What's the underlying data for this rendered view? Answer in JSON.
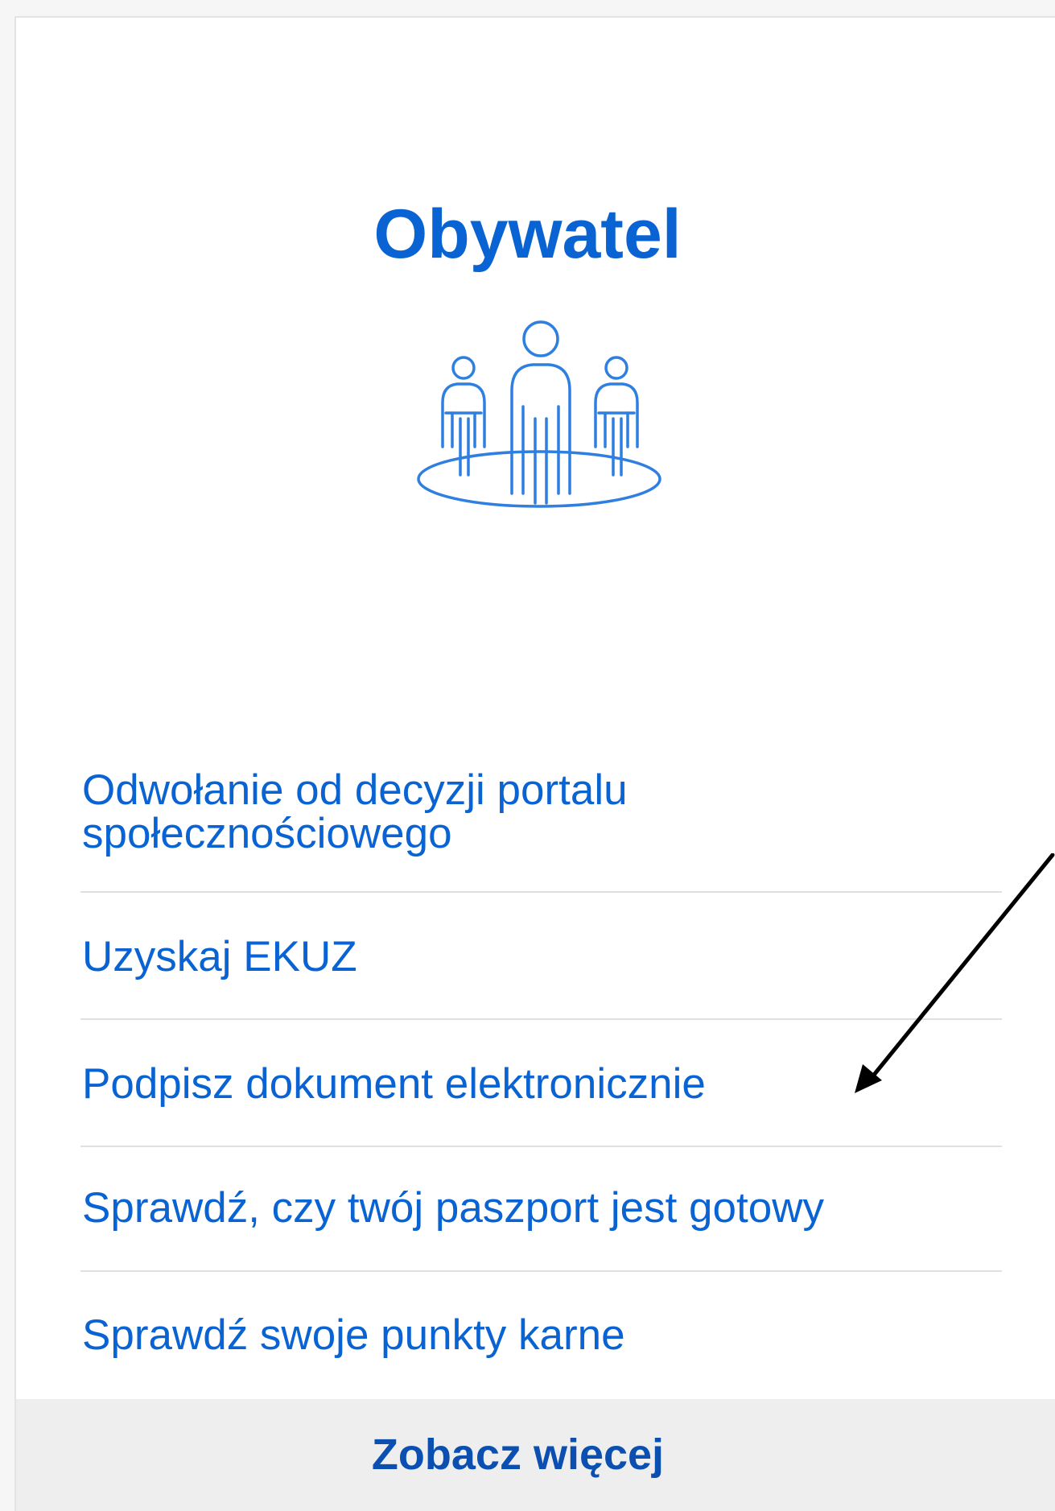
{
  "card": {
    "title": "Obywatel",
    "icon": "people-group-icon",
    "links": [
      {
        "label_line1": "Odwołanie od decyzji portalu",
        "label_line2": "społecznościowego"
      },
      {
        "label_line1": "Uzyskaj EKUZ"
      },
      {
        "label_line1": "Podpisz dokument elektronicznie"
      },
      {
        "label_line1": "Sprawdź, czy twój paszport jest gotowy"
      },
      {
        "label_line1": "Sprawdź swoje punkty karne"
      }
    ],
    "footer_label": "Zobacz więcej"
  },
  "annotation": {
    "icon": "arrow-icon",
    "color": "#000000"
  },
  "colors": {
    "link": "#0a63d3",
    "footer_text": "#0b4fb0",
    "footer_bg": "#eeeeee"
  }
}
